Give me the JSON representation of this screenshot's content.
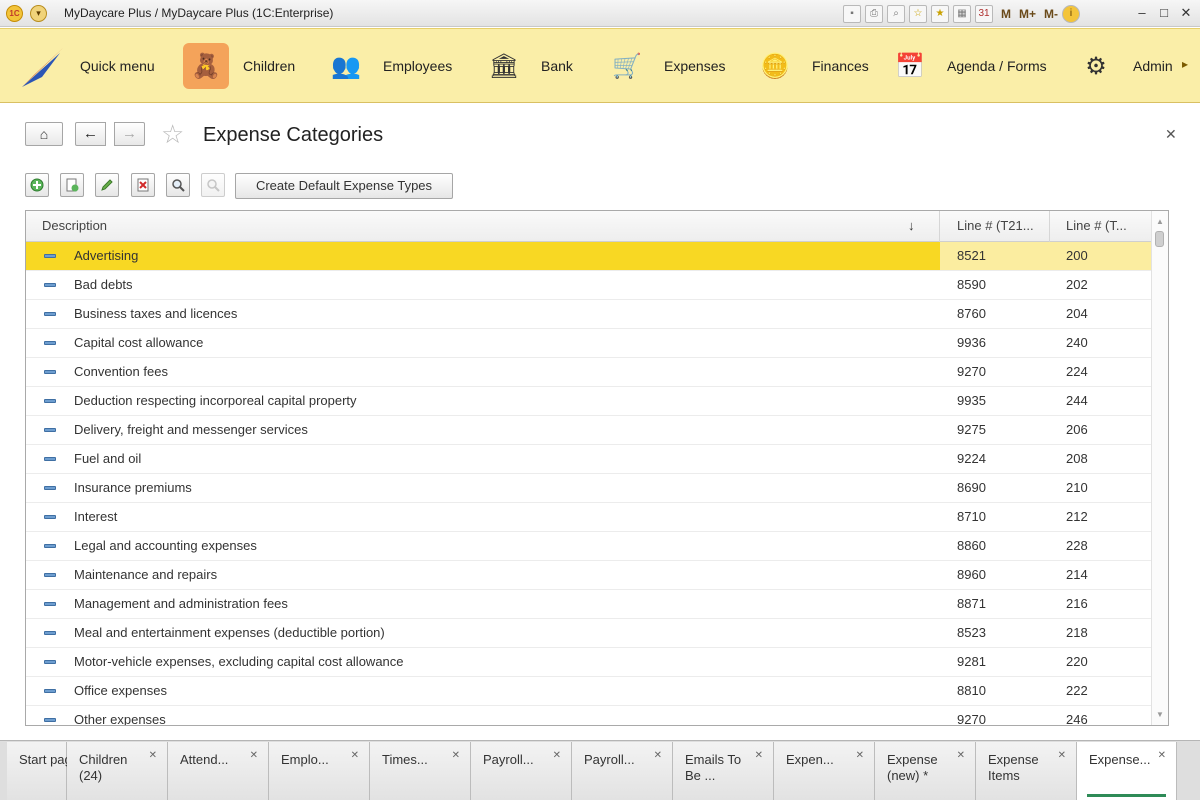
{
  "window": {
    "title": "MyDaycare Plus / MyDaycare Plus  (1C:Enterprise)",
    "toolbar_texts": [
      "M",
      "M+",
      "M-"
    ]
  },
  "sections": [
    {
      "label": "Quick menu",
      "icon": "quick-menu-icon"
    },
    {
      "label": "Children",
      "icon": "children-icon"
    },
    {
      "label": "Employees",
      "icon": "employees-icon"
    },
    {
      "label": "Bank",
      "icon": "bank-icon"
    },
    {
      "label": "Expenses",
      "icon": "expenses-icon"
    },
    {
      "label": "Finances",
      "icon": "finances-icon"
    },
    {
      "label": "Agenda / Forms",
      "icon": "agenda-icon"
    },
    {
      "label": "Admin",
      "icon": "admin-icon"
    }
  ],
  "form": {
    "title": "Expense Categories",
    "create_default_label": "Create Default Expense Types"
  },
  "table": {
    "columns": [
      "Description",
      "Line # (T21...",
      "Line # (T..."
    ],
    "sort_indicator": "↓",
    "rows": [
      {
        "description": "Advertising",
        "line1": "8521",
        "line2": "200"
      },
      {
        "description": "Bad debts",
        "line1": "8590",
        "line2": "202"
      },
      {
        "description": "Business taxes and licences",
        "line1": "8760",
        "line2": "204"
      },
      {
        "description": "Capital cost allowance",
        "line1": "9936",
        "line2": "240"
      },
      {
        "description": "Convention fees",
        "line1": "9270",
        "line2": "224"
      },
      {
        "description": "Deduction respecting incorporeal capital property",
        "line1": "9935",
        "line2": "244"
      },
      {
        "description": "Delivery, freight and messenger services",
        "line1": "9275",
        "line2": "206"
      },
      {
        "description": "Fuel and oil",
        "line1": "9224",
        "line2": "208"
      },
      {
        "description": "Insurance premiums",
        "line1": "8690",
        "line2": "210"
      },
      {
        "description": "Interest",
        "line1": "8710",
        "line2": "212"
      },
      {
        "description": "Legal and accounting expenses",
        "line1": "8860",
        "line2": "228"
      },
      {
        "description": "Maintenance and repairs",
        "line1": "8960",
        "line2": "214"
      },
      {
        "description": "Management and administration fees",
        "line1": "8871",
        "line2": "216"
      },
      {
        "description": "Meal and entertainment expenses (deductible portion)",
        "line1": "8523",
        "line2": "218"
      },
      {
        "description": "Motor-vehicle expenses, excluding capital cost allowance",
        "line1": "9281",
        "line2": "220"
      },
      {
        "description": "Office expenses",
        "line1": "8810",
        "line2": "222"
      },
      {
        "description": "Other expenses",
        "line1": "9270",
        "line2": "246"
      }
    ]
  },
  "tabs": [
    {
      "label": "Start page",
      "closable": false
    },
    {
      "label": "Children (24)",
      "closable": true
    },
    {
      "label": "Attend...",
      "closable": true
    },
    {
      "label": "Emplo...",
      "closable": true
    },
    {
      "label": "Times...",
      "closable": true
    },
    {
      "label": "Payroll...",
      "closable": true
    },
    {
      "label": "Payroll...",
      "closable": true
    },
    {
      "label": "Emails To Be ...",
      "closable": true
    },
    {
      "label": "Expen...",
      "closable": true
    },
    {
      "label": "Expense (new) *",
      "closable": true
    },
    {
      "label": "Expense Items",
      "closable": true
    },
    {
      "label": "Expense...",
      "closable": true
    }
  ]
}
